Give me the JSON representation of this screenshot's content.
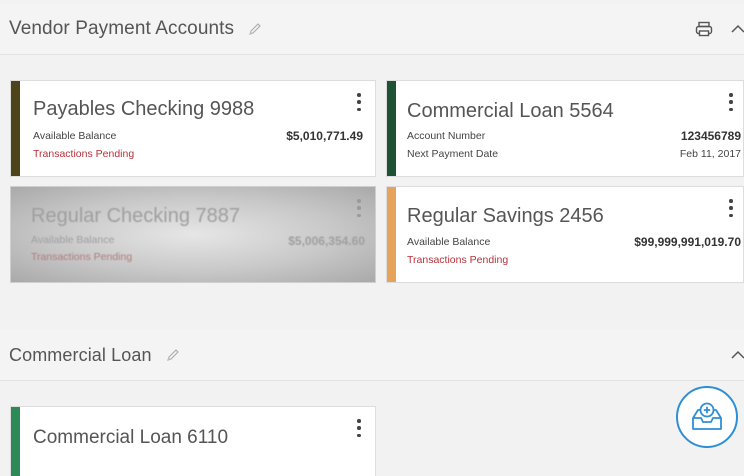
{
  "colors": {
    "accent_dark_olive": "#4d4419",
    "accent_dark_green": "#1f5135",
    "accent_orange": "#e6a35c",
    "accent_green": "#2b8a55",
    "pending_red": "#b5323a",
    "fab_blue": "#2f8fd6"
  },
  "sections": {
    "vendor": {
      "title": "Vendor Payment Accounts",
      "icons": [
        "pencil-icon",
        "printer-icon",
        "chevron-up-icon"
      ],
      "cards": [
        {
          "title": "Payables Checking 9988",
          "row1_label": "Available Balance",
          "row1_value": "$5,010,771.49",
          "row2_label": "Transactions Pending"
        },
        {
          "title": "Commercial Loan 5564",
          "row1_label": "Account Number",
          "row1_value": "123456789",
          "row2_label": "Next Payment Date",
          "row2_value": "Feb 11, 2017"
        },
        {
          "title": "Regular Checking 7887",
          "row1_label": "Available Balance",
          "row1_value": "$5,006,354.60",
          "row2_label": "Transactions Pending"
        },
        {
          "title": "Regular Savings 2456",
          "row1_label": "Available Balance",
          "row1_value": "$99,999,991,019.70",
          "row2_label": "Transactions Pending"
        }
      ]
    },
    "loan": {
      "title": "Commercial Loan",
      "icons": [
        "pencil-icon",
        "chevron-up-icon"
      ],
      "cards": [
        {
          "title": "Commercial Loan 6110"
        }
      ]
    }
  },
  "fab": {
    "icon": "inbox-add-icon"
  }
}
